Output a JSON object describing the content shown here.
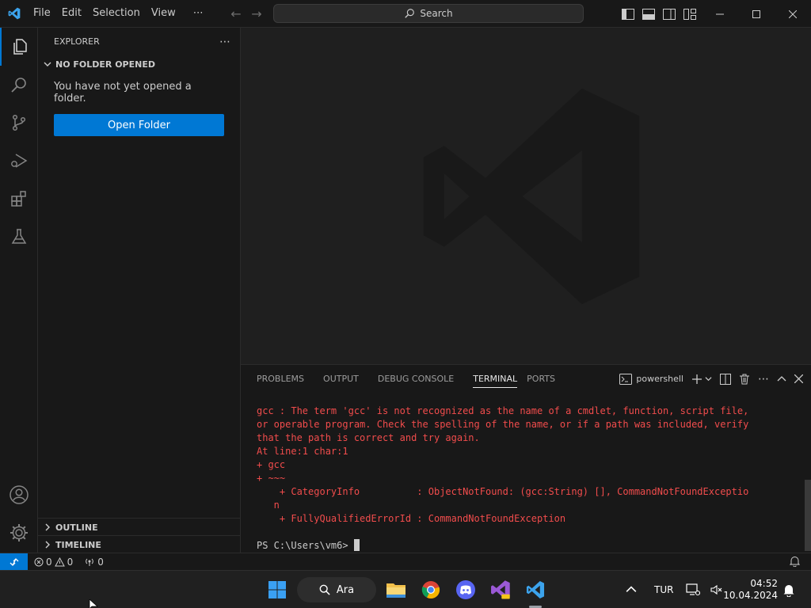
{
  "titlebar": {
    "menu": [
      "File",
      "Edit",
      "Selection",
      "View"
    ],
    "more": "⋯",
    "search_label": "Search"
  },
  "colors": {
    "accent": "#0078d4",
    "error_text": "#f14c4c",
    "background": "#1f1f1f",
    "chrome": "#181818"
  },
  "activitybar": {
    "items": [
      "explorer-icon",
      "search-icon",
      "source-control-icon",
      "run-debug-icon",
      "extensions-icon",
      "testing-icon"
    ],
    "bottom": [
      "accounts-icon",
      "manage-gear-icon"
    ]
  },
  "sidebar": {
    "title": "EXPLORER",
    "more": "⋯",
    "section_title": "NO FOLDER OPENED",
    "message": "You have not yet opened a folder.",
    "open_folder_label": "Open Folder",
    "outline_label": "OUTLINE",
    "timeline_label": "TIMELINE"
  },
  "panel": {
    "tabs": [
      "PROBLEMS",
      "OUTPUT",
      "DEBUG CONSOLE",
      "TERMINAL",
      "PORTS"
    ],
    "active_tab": "TERMINAL",
    "shell_name": "powershell",
    "terminal_lines": [
      "gcc : The term 'gcc' is not recognized as the name of a cmdlet, function, script file,",
      "or operable program. Check the spelling of the name, or if a path was included, verify",
      "that the path is correct and try again.",
      "At line:1 char:1",
      "+ gcc",
      "+ ~~~",
      "    + CategoryInfo          : ObjectNotFound: (gcc:String) [], CommandNotFoundExceptio",
      "   n",
      "    + FullyQualifiedErrorId : CommandNotFoundException"
    ],
    "prompt": "PS C:\\Users\\vm6> "
  },
  "statusbar": {
    "errors": "0",
    "warnings": "0",
    "ports": "0"
  },
  "taskbar": {
    "search_label": "Ara",
    "language": "TUR",
    "time": "04:52",
    "date": "10.04.2024",
    "apps": [
      "windows-start-icon",
      "file-explorer-icon",
      "chrome-icon",
      "discord-icon",
      "visual-studio-preview-icon",
      "vscode-icon"
    ]
  }
}
